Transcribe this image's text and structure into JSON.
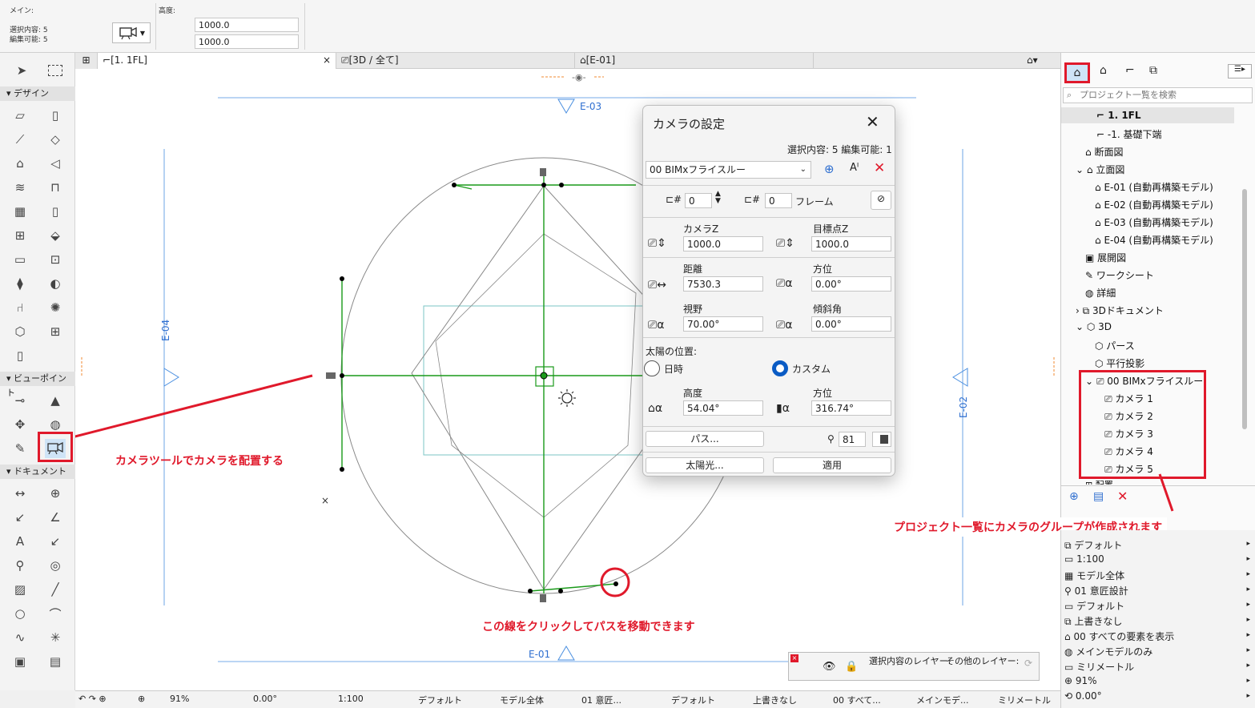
{
  "info_bar": {
    "main_label": "メイン:",
    "selected_label": "選択内容: 5",
    "editable_label": "編集可能: 5",
    "height_label": "高度:",
    "height_value_1": "1000.0",
    "height_value_2": "1000.0"
  },
  "toolbox": {
    "design_section": "デザイン",
    "viewpoint_section": "ビューポイント",
    "document_section": "ドキュメント"
  },
  "tabs": [
    {
      "label": "[1. 1FL]"
    },
    {
      "label": "[3D / 全て]"
    },
    {
      "label": "[E-01]"
    }
  ],
  "canvas": {
    "markers": {
      "e03": "E-03",
      "e04": "E-04",
      "e02": "E-02",
      "e01": "E-01"
    }
  },
  "dialog": {
    "title": "カメラの設定",
    "selection_info": "選択内容: 5 編集可能: 1",
    "preset": "00  BIMxフライスルー",
    "camera_index": "0",
    "frame_value": "0",
    "frame_label": "フレーム",
    "camera_z_label": "カメラZ",
    "camera_z_value": "1000.0",
    "target_z_label": "目標点Z",
    "target_z_value": "1000.0",
    "distance_label": "距離",
    "distance_value": "7530.3",
    "azimuth_label": "方位",
    "azimuth_value": "0.00°",
    "fov_label": "視野",
    "fov_value": "70.00°",
    "tilt_label": "傾斜角",
    "tilt_value": "0.00°",
    "sun_position_label": "太陽の位置:",
    "datetime_label": "日時",
    "custom_label": "カスタム",
    "sun_altitude_label": "高度",
    "sun_altitude_value": "54.04°",
    "sun_azimuth_label": "方位",
    "sun_azimuth_value": "316.74°",
    "path_button": "パス...",
    "pen_value": "81",
    "sunlight_button": "太陽光...",
    "apply_button": "適用"
  },
  "navigator": {
    "search_placeholder": "プロジェクト一覧を検索",
    "items": [
      {
        "label": "1. 1FL"
      },
      {
        "label": "-1. 基礎下端"
      },
      {
        "label": "断面図"
      },
      {
        "label": "立面図"
      },
      {
        "label": "E-01 (自動再構築モデル)"
      },
      {
        "label": "E-02 (自動再構築モデル)"
      },
      {
        "label": "E-03 (自動再構築モデル)"
      },
      {
        "label": "E-04 (自動再構築モデル)"
      },
      {
        "label": "展開図"
      },
      {
        "label": "ワークシート"
      },
      {
        "label": "詳細"
      },
      {
        "label": "3Dドキュメント"
      },
      {
        "label": "3D"
      },
      {
        "label": "パース"
      },
      {
        "label": "平行投影"
      },
      {
        "label": "00 BIMxフライスルー"
      },
      {
        "label": "カメラ 1"
      },
      {
        "label": "カメラ 2"
      },
      {
        "label": "カメラ 3"
      },
      {
        "label": "カメラ 4"
      },
      {
        "label": "カメラ 5"
      },
      {
        "label": "配置"
      }
    ]
  },
  "quick_options": [
    {
      "label": "デフォルト"
    },
    {
      "label": "1:100"
    },
    {
      "label": "モデル全体"
    },
    {
      "label": "01 意匠設計"
    },
    {
      "label": "デフォルト"
    },
    {
      "label": "上書きなし"
    },
    {
      "label": "00 すべての要素を表示"
    },
    {
      "label": "メインモデルのみ"
    },
    {
      "label": "ミリメートル"
    },
    {
      "label": "91%"
    },
    {
      "label": "0.00°"
    }
  ],
  "layer_panel": {
    "selection_layer": "選択内容のレイヤー:",
    "other_layer": "その他のレイヤー:"
  },
  "status_bar": {
    "zoom": "91%",
    "angle": "0.00°",
    "scale": "1:100",
    "layer_combo": "デフォルト",
    "model_view": "モデル全体",
    "pen_set": "01 意匠...",
    "graphic": "デフォルト",
    "override": "上書きなし",
    "renovation": "00 すべて...",
    "structure": "メインモデ...",
    "units": "ミリメートル"
  },
  "annotations": {
    "camera_tool": "カメラツールでカメラを配置する",
    "path_move": "この線をクリックしてパスを移動できます",
    "group_created": "プロジェクト一覧にカメラのグループが作成されます"
  },
  "colors": {
    "accent_red": "#e0192b",
    "plan_green": "#1a9a1a",
    "marker_blue": "#2f6fd0"
  }
}
